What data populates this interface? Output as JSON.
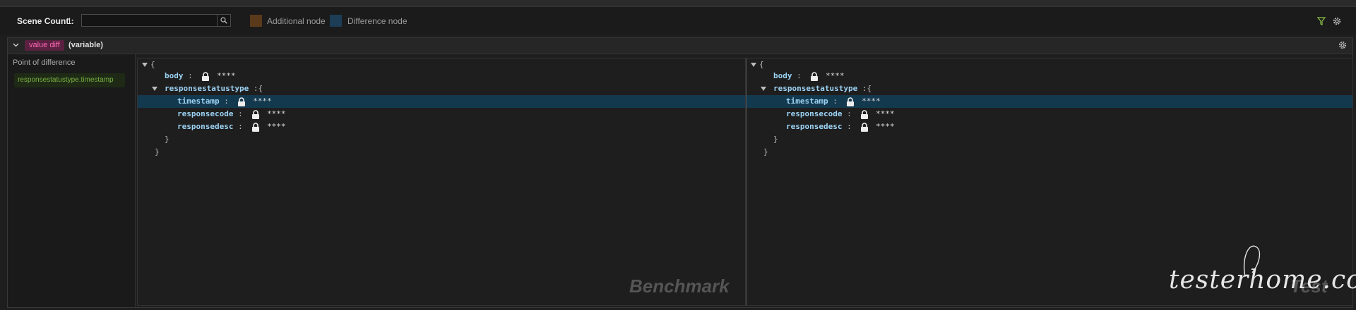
{
  "toolbar": {
    "scene_count_label": "Scene Count :",
    "scene_count_value": "1",
    "search_value": "",
    "search_placeholder": "",
    "legend": [
      {
        "label": "Additional node",
        "color": "#5a3a1a"
      },
      {
        "label": "Difference node",
        "color": "#1c3d55"
      }
    ]
  },
  "panel": {
    "tag": "value diff",
    "tag_sub": "(variable)",
    "sidebar": {
      "title": "Point of difference",
      "items": [
        "responsestatustype.timestamp"
      ]
    },
    "tree": {
      "open": "{",
      "close": "}",
      "body_key": "body",
      "rst_key": "responsestatustype",
      "timestamp_key": "timestamp",
      "responsecode_key": "responsecode",
      "responsedesc_key": "responsedesc",
      "sep": ":",
      "mask": "****"
    },
    "left_watermark": "Benchmark",
    "right_watermark": "Test"
  },
  "logo_text": "testerhome.com"
}
